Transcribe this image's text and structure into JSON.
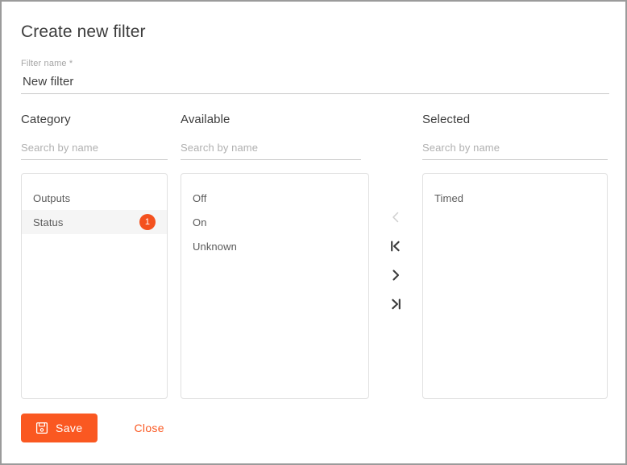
{
  "dialog": {
    "title": "Create new filter"
  },
  "filter_name": {
    "label": "Filter name *",
    "value": "New filter",
    "placeholder": "Filter name"
  },
  "columns": {
    "category": {
      "heading": "Category",
      "search_placeholder": "Search by name",
      "search_value": "",
      "items": [
        {
          "label": "Outputs",
          "badge": "",
          "selected": false
        },
        {
          "label": "Status",
          "badge": "1",
          "selected": true
        }
      ]
    },
    "available": {
      "heading": "Available",
      "search_placeholder": "Search by name",
      "search_value": "",
      "items": [
        {
          "label": "Off"
        },
        {
          "label": "On"
        },
        {
          "label": "Unknown"
        }
      ]
    },
    "selected": {
      "heading": "Selected",
      "search_placeholder": "Search by name",
      "search_value": "",
      "items": [
        {
          "label": "Timed"
        }
      ]
    }
  },
  "transfer_buttons": [
    {
      "name": "move-left-icon",
      "glyph": "<",
      "enabled": false
    },
    {
      "name": "move-all-left-icon",
      "glyph": "|<",
      "enabled": true
    },
    {
      "name": "move-right-icon",
      "glyph": ">",
      "enabled": true
    },
    {
      "name": "move-all-right-icon",
      "glyph": ">|",
      "enabled": true
    }
  ],
  "footer": {
    "save_label": "Save",
    "close_label": "Close"
  },
  "colors": {
    "accent": "#fa5821",
    "badge": "#f4511e",
    "text": "#3c3c3c",
    "muted": "#b0b0b0",
    "border": "#e0e0e0",
    "row_selected": "#f5f5f5"
  }
}
